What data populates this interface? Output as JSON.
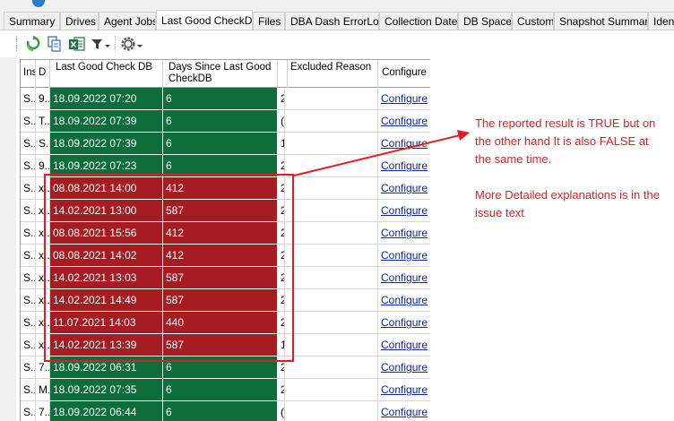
{
  "tabs": [
    {
      "label": "Summary",
      "active": false
    },
    {
      "label": "Drives",
      "active": false
    },
    {
      "label": "Agent Jobs",
      "active": false
    },
    {
      "label": "Last Good CheckDB",
      "active": true
    },
    {
      "label": "Files",
      "active": false
    },
    {
      "label": "DBA Dash ErrorLog",
      "active": false
    },
    {
      "label": "Collection Dates",
      "active": false
    },
    {
      "label": "DB Space",
      "active": false
    },
    {
      "label": "Custom",
      "active": false
    },
    {
      "label": "Snapshot Summary",
      "active": false
    },
    {
      "label": "Identi",
      "active": false
    }
  ],
  "toolbar": {
    "icons": [
      "refresh-icon",
      "copy-icon",
      "excel-export-icon",
      "filter-dropdown-icon",
      "settings-dropdown-icon"
    ]
  },
  "grid": {
    "columns": [
      "Ins",
      "D",
      "Last Good Check DB",
      "Days Since Last Good CheckDB",
      "",
      "Excluded Reason",
      "Configure"
    ],
    "rows": [
      {
        "ins": "S...",
        "d": "9...",
        "last": "18.09.2022 07:20",
        "days": "6",
        "x": "2",
        "reason": "",
        "link": "Configure",
        "status": "ok"
      },
      {
        "ins": "S...",
        "d": "T...",
        "last": "18.09.2022 07:39",
        "days": "6",
        "x": "(",
        "reason": "",
        "link": "Configure",
        "status": "ok"
      },
      {
        "ins": "S...",
        "d": "S...",
        "last": "18.09.2022 07:39",
        "days": "6",
        "x": "1",
        "reason": "",
        "link": "Configure",
        "status": "ok"
      },
      {
        "ins": "S...",
        "d": "9...",
        "last": "18.09.2022 07:23",
        "days": "6",
        "x": "2",
        "reason": "",
        "link": "Configure",
        "status": "ok"
      },
      {
        "ins": "S...",
        "d": "x...",
        "last": "08.08.2021 14:00",
        "days": "412",
        "x": "2",
        "reason": "",
        "link": "Configure",
        "status": "bad"
      },
      {
        "ins": "S...",
        "d": "x...",
        "last": "14.02.2021 13:00",
        "days": "587",
        "x": "2",
        "reason": "",
        "link": "Configure",
        "status": "bad"
      },
      {
        "ins": "S...",
        "d": "x...",
        "last": "08.08.2021 15:56",
        "days": "412",
        "x": "2",
        "reason": "",
        "link": "Configure",
        "status": "bad"
      },
      {
        "ins": "S...",
        "d": "x...",
        "last": "08.08.2021 14:02",
        "days": "412",
        "x": "2",
        "reason": "",
        "link": "Configure",
        "status": "bad"
      },
      {
        "ins": "S...",
        "d": "x...",
        "last": "14.02.2021 13:03",
        "days": "587",
        "x": "2",
        "reason": "",
        "link": "Configure",
        "status": "bad"
      },
      {
        "ins": "S...",
        "d": "x...",
        "last": "14.02.2021 14:49",
        "days": "587",
        "x": "2",
        "reason": "",
        "link": "Configure",
        "status": "bad"
      },
      {
        "ins": "S...",
        "d": "x...",
        "last": "11.07.2021 14:03",
        "days": "440",
        "x": "2",
        "reason": "",
        "link": "Configure",
        "status": "bad"
      },
      {
        "ins": "S...",
        "d": "x...",
        "last": "14.02.2021 13:39",
        "days": "587",
        "x": "1",
        "reason": "",
        "link": "Configure",
        "status": "bad"
      },
      {
        "ins": "S...",
        "d": "7...",
        "last": "18.09.2022 06:31",
        "days": "6",
        "x": "2",
        "reason": "",
        "link": "Configure",
        "status": "ok"
      },
      {
        "ins": "S...",
        "d": "M...",
        "last": "18.09.2022 07:35",
        "days": "6",
        "x": "2",
        "reason": "",
        "link": "Configure",
        "status": "ok"
      },
      {
        "ins": "S...",
        "d": "7...",
        "last": "18.09.2022 06:44",
        "days": "6",
        "x": "(",
        "reason": "",
        "link": "Configure",
        "status": "ok"
      }
    ]
  },
  "colors": {
    "ok": "#0d6d3b",
    "bad": "#a51d22",
    "link": "#0b24a8",
    "annotation": "#e21c23"
  },
  "annotation": {
    "line1": "The reported result is TRUE but on the other hand It is also FALSE at the same time.",
    "line2": "More Detailed explanations is in the issue text"
  }
}
